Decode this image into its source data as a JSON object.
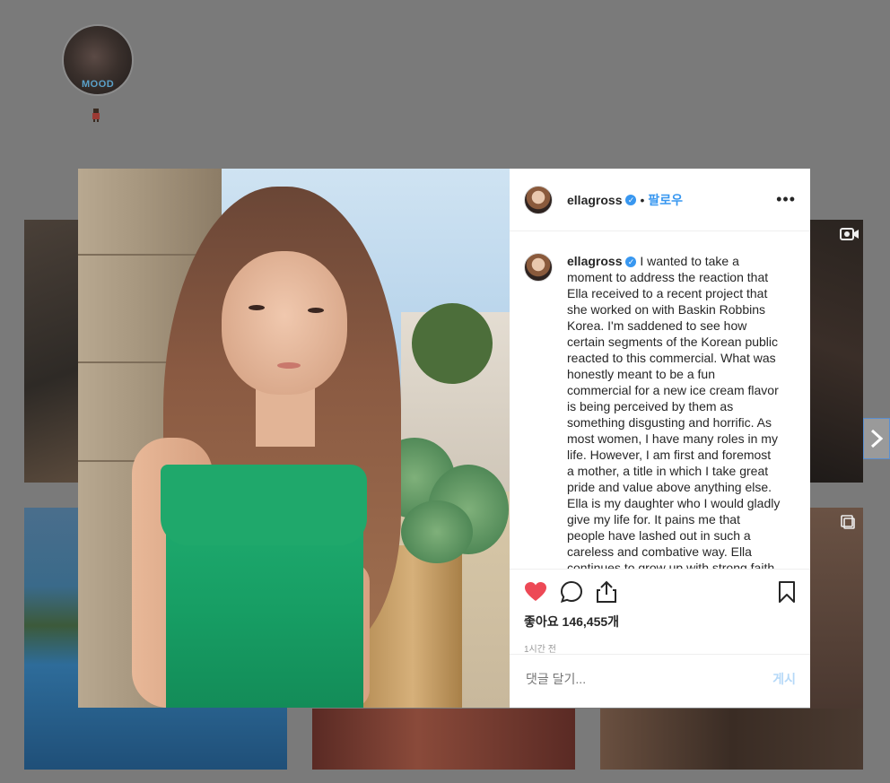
{
  "background": {
    "profile_badge_text": "MOOD"
  },
  "post": {
    "username": "ellagross",
    "follow_label": "팔로우",
    "separator": "•",
    "more_label": "•••",
    "caption_username": "ellagross",
    "caption": "I wanted to take a moment to address the reaction that Ella received to a recent project that she worked on with Baskin Robbins Korea. I'm saddened to see how certain segments of the Korean public reacted to this commercial. What was honestly meant to be a fun commercial for a new ice cream flavor is being perceived by them as something disgusting and horrific. As most women, I have many roles in my life. However, I am first and foremost a mother, a title in which I take great pride and value above anything else. Ella is my daughter who I would gladly give my life for. It pains me that people have lashed out in such a careless and combative way. Ella continues to grow up with strong faith",
    "likes_label": "좋아요 146,455개",
    "time_label": "1시간 전",
    "comment_placeholder": "댓글 달기...",
    "post_button_label": "게시"
  },
  "colors": {
    "accent": "#3897f0",
    "like": "#ed4956",
    "overlay": "#7a7a7a"
  }
}
